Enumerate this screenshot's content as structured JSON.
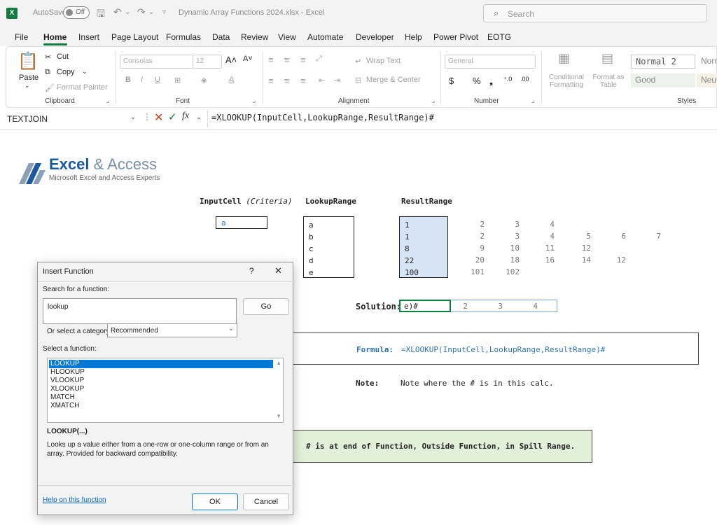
{
  "titlebar": {
    "logo": "X",
    "autosave_label": "AutoSave",
    "autosave_state": "Off",
    "file_title": "Dynamic Array Functions 2024.xlsx  -  Excel",
    "search_placeholder": "Search"
  },
  "menu": {
    "tabs": [
      "File",
      "Home",
      "Insert",
      "Page Layout",
      "Formulas",
      "Data",
      "Review",
      "View",
      "Automate",
      "Developer",
      "Help",
      "Power Pivot",
      "EOTG"
    ]
  },
  "ribbon": {
    "clipboard": {
      "paste": "Paste",
      "cut": "Cut",
      "copy": "Copy",
      "format_painter": "Format Painter",
      "label": "Clipboard"
    },
    "font": {
      "name": "Consolas",
      "size": "12",
      "label": "Font"
    },
    "alignment": {
      "wrap_text": "Wrap Text",
      "merge_center": "Merge & Center",
      "label": "Alignment"
    },
    "number": {
      "format": "General",
      "label": "Number"
    },
    "styles": {
      "conditional": "Conditional Formatting",
      "format_as": "Format as Table",
      "normal2": "Normal 2",
      "normal": "Norm",
      "good": "Good",
      "neutral": "Neutr",
      "label": "Styles"
    }
  },
  "formula_bar": {
    "name_box": "TEXTJOIN",
    "formula": "=XLOOKUP(InputCell,LookupRange,ResultRange)#"
  },
  "sheet": {
    "logo_main_a": "Excel",
    "logo_main_b": " & Access",
    "logo_sub": "Microsoft Excel and Access Experts",
    "headers": {
      "input": "InputCell",
      "criteria": "(Criteria)",
      "lookup": "LookupRange",
      "result": "ResultRange"
    },
    "input_value": "a",
    "lookup_values": [
      "a",
      "b",
      "c",
      "d",
      "e"
    ],
    "result_values": [
      "1",
      "1",
      "8",
      "22",
      "100"
    ],
    "result_rows": [
      [
        "2",
        "3",
        "4",
        "",
        "",
        ""
      ],
      [
        "2",
        "3",
        "4",
        "5",
        "6",
        "7"
      ],
      [
        "9",
        "10",
        "11",
        "12",
        "",
        ""
      ],
      [
        "20",
        "18",
        "16",
        "14",
        "12",
        ""
      ],
      [
        "101",
        "102",
        "",
        "",
        "",
        ""
      ]
    ],
    "solution_label": "Solution:",
    "solution_edit": "e)#",
    "solution_spill": [
      "2",
      "3",
      "4"
    ],
    "formula_label": "Formula:",
    "formula_text": "=XLOOKUP(InputCell,LookupRange,ResultRange)#",
    "note_label": "Note:",
    "note_text": "Note where the # is in this calc.",
    "callout": "# is at end of Function, Outside Function, in Spill Range."
  },
  "dialog": {
    "title": "Insert Function",
    "help_q": "?",
    "close": "✕",
    "search_label": "Search for a function:",
    "search_value": "lookup",
    "go": "Go",
    "category_label": "Or select a category:",
    "category_value": "Recommended",
    "select_label": "Select a function:",
    "functions": [
      "LOOKUP",
      "HLOOKUP",
      "VLOOKUP",
      "XLOOKUP",
      "MATCH",
      "XMATCH"
    ],
    "selected_sig": "LOOKUP(...)",
    "description": "Looks up a value either from a one-row or one-column range or from an array. Provided for backward compatibility.",
    "help_link": "Help on this function",
    "ok": "OK",
    "cancel": "Cancel"
  },
  "colors": {
    "excel_green": "#107c41",
    "result_fill": "#d6e4f5",
    "callout_fill": "#e2f0d9",
    "formula_blue": "#2e75b6",
    "select_blue": "#0078d7"
  }
}
